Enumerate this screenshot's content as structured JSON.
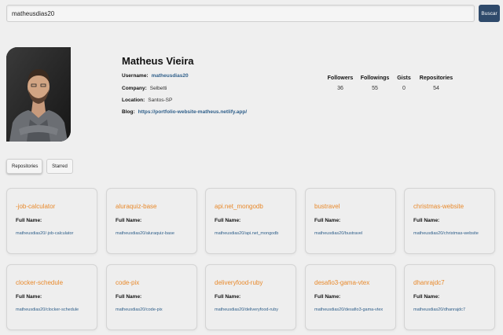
{
  "search": {
    "value": "matheusdias20",
    "button_label": "Buscar"
  },
  "profile": {
    "name": "Matheus Vieira",
    "username_label": "Username:",
    "username": "matheusdias20",
    "company_label": "Company:",
    "company": "Selbetti",
    "location_label": "Location:",
    "location": "Santos-SP",
    "blog_label": "Blog:",
    "blog": "https://portfolio-website-matheus.netlify.app/"
  },
  "stats": [
    {
      "label": "Followers",
      "value": "36"
    },
    {
      "label": "Followings",
      "value": "55"
    },
    {
      "label": "Gists",
      "value": "0"
    },
    {
      "label": "Repositories",
      "value": "54"
    }
  ],
  "tabs": [
    {
      "label": "Repositories",
      "active": true
    },
    {
      "label": "Starred",
      "active": false
    }
  ],
  "repos": [
    {
      "name": "-job-calculator",
      "full_label": "Full Name:",
      "full_name": "matheusdias20/-job-calculator"
    },
    {
      "name": "aluraquiz-base",
      "full_label": "Full Name:",
      "full_name": "matheusdias20/aluraquiz-base"
    },
    {
      "name": "api.net_mongodb",
      "full_label": "Full Name:",
      "full_name": "matheusdias20/api.net_mongodb"
    },
    {
      "name": "bustravel",
      "full_label": "Full Name:",
      "full_name": "matheusdias20/bustravel"
    },
    {
      "name": "christmas-website",
      "full_label": "Full Name:",
      "full_name": "matheusdias20/christmas-website"
    },
    {
      "name": "clocker-schedule",
      "full_label": "Full Name:",
      "full_name": "matheusdias20/clocker-schedule"
    },
    {
      "name": "code-pix",
      "full_label": "Full Name:",
      "full_name": "matheusdias20/code-pix"
    },
    {
      "name": "deliveryfood-ruby",
      "full_label": "Full Name:",
      "full_name": "matheusdias20/deliveryfood-ruby"
    },
    {
      "name": "desafio3-gama-vtex",
      "full_label": "Full Name:",
      "full_name": "matheusdias20/desafio3-gama-vtex"
    },
    {
      "name": "dhanrajdc7",
      "full_label": "Full Name:",
      "full_name": "matheusdias20/dhanrajdc7"
    }
  ],
  "colors": {
    "accent": "#e8892b",
    "link": "#2f5f8a",
    "button": "#2f4a6b",
    "background": "#efefef"
  }
}
